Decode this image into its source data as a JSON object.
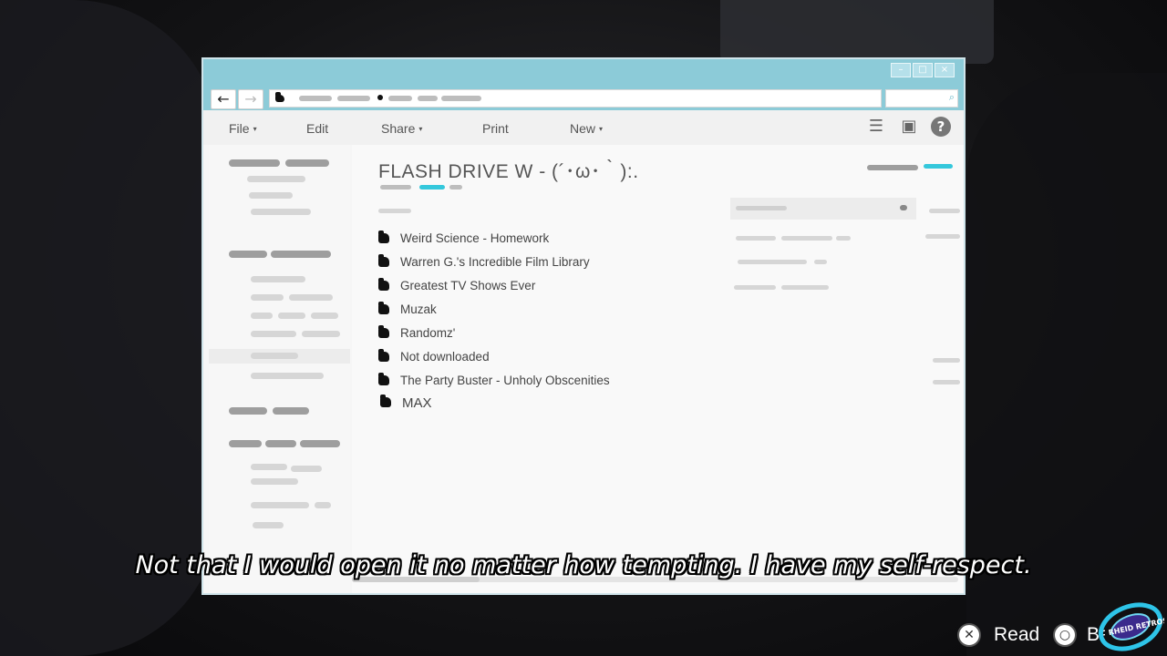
{
  "window": {
    "controls": [
      "–",
      "□",
      "×"
    ],
    "nav": {
      "back": "←",
      "forward": "→"
    }
  },
  "menu": {
    "file": "File",
    "edit": "Edit",
    "share": "Share",
    "print": "Print",
    "new": "New",
    "caret": "▾"
  },
  "toolbar_icons": [
    "list-view-icon",
    "panel-icon",
    "help-icon"
  ],
  "folder": {
    "title": "FLASH DRIVE W - (´･ω･｀):.",
    "items": [
      "Weird Science - Homework",
      "Warren G.'s Incredible Film Library",
      "Greatest TV Shows Ever",
      "Muzak",
      "Randomz'",
      "Not downloaded",
      "The Party Buster - Unholy Obscenities",
      "MAX"
    ]
  },
  "subtitle": "Not that I would open it no matter how tempting.  I have my self-respect.",
  "hud": {
    "read_label": "Read",
    "back_label": "Back",
    "read_button": "✕",
    "back_button": "○"
  },
  "logo_text": "RHEID RETROSPECT",
  "colors": {
    "window_frame": "#8ccbd8",
    "accent": "#35c8dc",
    "subtitle_text": "#ffffff"
  }
}
